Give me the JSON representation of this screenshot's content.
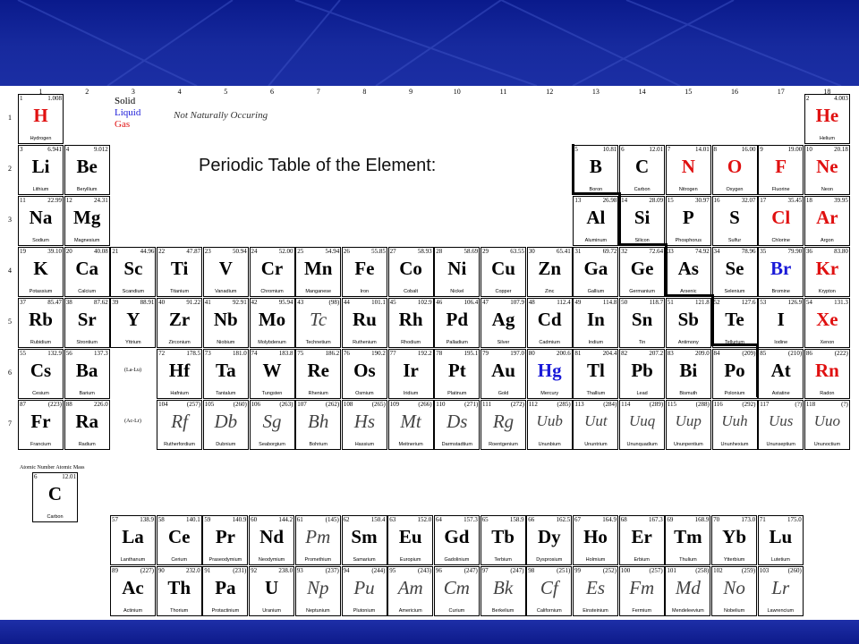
{
  "title": "Periodic Table of the Element:",
  "legend": {
    "solid": "Solid",
    "liquid": "Liquid",
    "gas": "Gas",
    "not_natural": "Not Naturally Occuring"
  },
  "group_numbers": [
    "1",
    "2",
    "3",
    "4",
    "5",
    "6",
    "7",
    "8",
    "9",
    "10",
    "11",
    "12",
    "13",
    "14",
    "15",
    "16",
    "17",
    "18"
  ],
  "period_numbers": [
    "1",
    "2",
    "3",
    "4",
    "5",
    "6",
    "7"
  ],
  "series_refs": {
    "lanthanide": "(La-Lu)",
    "actinide": "(Ac-Lr)"
  },
  "key": {
    "label": "Atomic Number  Atomic Mass",
    "element": {
      "num": "6",
      "mass": "12.01",
      "sym": "C",
      "name": "Carbon"
    }
  },
  "colors": {
    "gas": "#e01010",
    "liquid": "#1a1ad8",
    "banner": "#172a9e"
  },
  "elements": [
    {
      "n": "1",
      "m": "1.008",
      "s": "H",
      "name": "Hydrogen",
      "st": "gas",
      "g": 1,
      "p": 1
    },
    {
      "n": "2",
      "m": "4.003",
      "s": "He",
      "name": "Helium",
      "st": "gas",
      "g": 18,
      "p": 1
    },
    {
      "n": "3",
      "m": "6.941",
      "s": "Li",
      "name": "Lithium",
      "st": "solid",
      "g": 1,
      "p": 2
    },
    {
      "n": "4",
      "m": "9.012",
      "s": "Be",
      "name": "Beryllium",
      "st": "solid",
      "g": 2,
      "p": 2
    },
    {
      "n": "5",
      "m": "10.81",
      "s": "B",
      "name": "Boron",
      "st": "solid",
      "g": 13,
      "p": 2
    },
    {
      "n": "6",
      "m": "12.01",
      "s": "C",
      "name": "Carbon",
      "st": "solid",
      "g": 14,
      "p": 2
    },
    {
      "n": "7",
      "m": "14.01",
      "s": "N",
      "name": "Nitrogen",
      "st": "gas",
      "g": 15,
      "p": 2
    },
    {
      "n": "8",
      "m": "16.00",
      "s": "O",
      "name": "Oxygen",
      "st": "gas",
      "g": 16,
      "p": 2
    },
    {
      "n": "9",
      "m": "19.00",
      "s": "F",
      "name": "Fluorine",
      "st": "gas",
      "g": 17,
      "p": 2
    },
    {
      "n": "10",
      "m": "20.18",
      "s": "Ne",
      "name": "Neon",
      "st": "gas",
      "g": 18,
      "p": 2
    },
    {
      "n": "11",
      "m": "22.99",
      "s": "Na",
      "name": "Sodium",
      "st": "solid",
      "g": 1,
      "p": 3
    },
    {
      "n": "12",
      "m": "24.31",
      "s": "Mg",
      "name": "Magnesium",
      "st": "solid",
      "g": 2,
      "p": 3
    },
    {
      "n": "13",
      "m": "26.98",
      "s": "Al",
      "name": "Aluminum",
      "st": "solid",
      "g": 13,
      "p": 3
    },
    {
      "n": "14",
      "m": "28.09",
      "s": "Si",
      "name": "Silicon",
      "st": "solid",
      "g": 14,
      "p": 3
    },
    {
      "n": "15",
      "m": "30.97",
      "s": "P",
      "name": "Phosphorus",
      "st": "solid",
      "g": 15,
      "p": 3
    },
    {
      "n": "16",
      "m": "32.07",
      "s": "S",
      "name": "Sulfur",
      "st": "solid",
      "g": 16,
      "p": 3
    },
    {
      "n": "17",
      "m": "35.45",
      "s": "Cl",
      "name": "Chlorine",
      "st": "gas",
      "g": 17,
      "p": 3
    },
    {
      "n": "18",
      "m": "39.95",
      "s": "Ar",
      "name": "Argon",
      "st": "gas",
      "g": 18,
      "p": 3
    },
    {
      "n": "19",
      "m": "39.10",
      "s": "K",
      "name": "Potassium",
      "st": "solid",
      "g": 1,
      "p": 4
    },
    {
      "n": "20",
      "m": "40.08",
      "s": "Ca",
      "name": "Calcium",
      "st": "solid",
      "g": 2,
      "p": 4
    },
    {
      "n": "21",
      "m": "44.96",
      "s": "Sc",
      "name": "Scandium",
      "st": "solid",
      "g": 3,
      "p": 4
    },
    {
      "n": "22",
      "m": "47.87",
      "s": "Ti",
      "name": "Titanium",
      "st": "solid",
      "g": 4,
      "p": 4
    },
    {
      "n": "23",
      "m": "50.94",
      "s": "V",
      "name": "Vanadium",
      "st": "solid",
      "g": 5,
      "p": 4
    },
    {
      "n": "24",
      "m": "52.00",
      "s": "Cr",
      "name": "Chromium",
      "st": "solid",
      "g": 6,
      "p": 4
    },
    {
      "n": "25",
      "m": "54.94",
      "s": "Mn",
      "name": "Manganese",
      "st": "solid",
      "g": 7,
      "p": 4
    },
    {
      "n": "26",
      "m": "55.85",
      "s": "Fe",
      "name": "Iron",
      "st": "solid",
      "g": 8,
      "p": 4
    },
    {
      "n": "27",
      "m": "58.93",
      "s": "Co",
      "name": "Cobalt",
      "st": "solid",
      "g": 9,
      "p": 4
    },
    {
      "n": "28",
      "m": "58.69",
      "s": "Ni",
      "name": "Nickel",
      "st": "solid",
      "g": 10,
      "p": 4
    },
    {
      "n": "29",
      "m": "63.55",
      "s": "Cu",
      "name": "Copper",
      "st": "solid",
      "g": 11,
      "p": 4
    },
    {
      "n": "30",
      "m": "65.41",
      "s": "Zn",
      "name": "Zinc",
      "st": "solid",
      "g": 12,
      "p": 4
    },
    {
      "n": "31",
      "m": "69.72",
      "s": "Ga",
      "name": "Gallium",
      "st": "solid",
      "g": 13,
      "p": 4
    },
    {
      "n": "32",
      "m": "72.64",
      "s": "Ge",
      "name": "Germanium",
      "st": "solid",
      "g": 14,
      "p": 4
    },
    {
      "n": "33",
      "m": "74.92",
      "s": "As",
      "name": "Arsenic",
      "st": "solid",
      "g": 15,
      "p": 4
    },
    {
      "n": "34",
      "m": "78.96",
      "s": "Se",
      "name": "Selenium",
      "st": "solid",
      "g": 16,
      "p": 4
    },
    {
      "n": "35",
      "m": "79.90",
      "s": "Br",
      "name": "Bromine",
      "st": "liquid",
      "g": 17,
      "p": 4
    },
    {
      "n": "36",
      "m": "83.80",
      "s": "Kr",
      "name": "Krypton",
      "st": "gas",
      "g": 18,
      "p": 4
    },
    {
      "n": "37",
      "m": "85.47",
      "s": "Rb",
      "name": "Rubidium",
      "st": "solid",
      "g": 1,
      "p": 5
    },
    {
      "n": "38",
      "m": "87.62",
      "s": "Sr",
      "name": "Strontium",
      "st": "solid",
      "g": 2,
      "p": 5
    },
    {
      "n": "39",
      "m": "88.91",
      "s": "Y",
      "name": "Yttrium",
      "st": "solid",
      "g": 3,
      "p": 5
    },
    {
      "n": "40",
      "m": "91.22",
      "s": "Zr",
      "name": "Zirconium",
      "st": "solid",
      "g": 4,
      "p": 5
    },
    {
      "n": "41",
      "m": "92.91",
      "s": "Nb",
      "name": "Niobium",
      "st": "solid",
      "g": 5,
      "p": 5
    },
    {
      "n": "42",
      "m": "95.94",
      "s": "Mo",
      "name": "Molybdenum",
      "st": "solid",
      "g": 6,
      "p": 5
    },
    {
      "n": "43",
      "m": "(98)",
      "s": "Tc",
      "name": "Technetium",
      "st": "synthetic",
      "g": 7,
      "p": 5
    },
    {
      "n": "44",
      "m": "101.1",
      "s": "Ru",
      "name": "Ruthenium",
      "st": "solid",
      "g": 8,
      "p": 5
    },
    {
      "n": "45",
      "m": "102.9",
      "s": "Rh",
      "name": "Rhodium",
      "st": "solid",
      "g": 9,
      "p": 5
    },
    {
      "n": "46",
      "m": "106.4",
      "s": "Pd",
      "name": "Palladium",
      "st": "solid",
      "g": 10,
      "p": 5
    },
    {
      "n": "47",
      "m": "107.9",
      "s": "Ag",
      "name": "Silver",
      "st": "solid",
      "g": 11,
      "p": 5
    },
    {
      "n": "48",
      "m": "112.4",
      "s": "Cd",
      "name": "Cadmium",
      "st": "solid",
      "g": 12,
      "p": 5
    },
    {
      "n": "49",
      "m": "114.8",
      "s": "In",
      "name": "Indium",
      "st": "solid",
      "g": 13,
      "p": 5
    },
    {
      "n": "50",
      "m": "118.7",
      "s": "Sn",
      "name": "Tin",
      "st": "solid",
      "g": 14,
      "p": 5
    },
    {
      "n": "51",
      "m": "121.8",
      "s": "Sb",
      "name": "Antimony",
      "st": "solid",
      "g": 15,
      "p": 5
    },
    {
      "n": "52",
      "m": "127.6",
      "s": "Te",
      "name": "Tellurium",
      "st": "solid",
      "g": 16,
      "p": 5
    },
    {
      "n": "53",
      "m": "126.9",
      "s": "I",
      "name": "Iodine",
      "st": "solid",
      "g": 17,
      "p": 5
    },
    {
      "n": "54",
      "m": "131.3",
      "s": "Xe",
      "name": "Xenon",
      "st": "gas",
      "g": 18,
      "p": 5
    },
    {
      "n": "55",
      "m": "132.9",
      "s": "Cs",
      "name": "Cesium",
      "st": "solid",
      "g": 1,
      "p": 6
    },
    {
      "n": "56",
      "m": "137.3",
      "s": "Ba",
      "name": "Barium",
      "st": "solid",
      "g": 2,
      "p": 6
    },
    {
      "n": "72",
      "m": "178.5",
      "s": "Hf",
      "name": "Hafnium",
      "st": "solid",
      "g": 4,
      "p": 6
    },
    {
      "n": "73",
      "m": "181.0",
      "s": "Ta",
      "name": "Tantalum",
      "st": "solid",
      "g": 5,
      "p": 6
    },
    {
      "n": "74",
      "m": "183.8",
      "s": "W",
      "name": "Tungsten",
      "st": "solid",
      "g": 6,
      "p": 6
    },
    {
      "n": "75",
      "m": "186.2",
      "s": "Re",
      "name": "Rhenium",
      "st": "solid",
      "g": 7,
      "p": 6
    },
    {
      "n": "76",
      "m": "190.2",
      "s": "Os",
      "name": "Osmium",
      "st": "solid",
      "g": 8,
      "p": 6
    },
    {
      "n": "77",
      "m": "192.2",
      "s": "Ir",
      "name": "Iridium",
      "st": "solid",
      "g": 9,
      "p": 6
    },
    {
      "n": "78",
      "m": "195.1",
      "s": "Pt",
      "name": "Platinum",
      "st": "solid",
      "g": 10,
      "p": 6
    },
    {
      "n": "79",
      "m": "197.0",
      "s": "Au",
      "name": "Gold",
      "st": "solid",
      "g": 11,
      "p": 6
    },
    {
      "n": "80",
      "m": "200.6",
      "s": "Hg",
      "name": "Mercury",
      "st": "liquid",
      "g": 12,
      "p": 6
    },
    {
      "n": "81",
      "m": "204.4",
      "s": "Tl",
      "name": "Thallium",
      "st": "solid",
      "g": 13,
      "p": 6
    },
    {
      "n": "82",
      "m": "207.2",
      "s": "Pb",
      "name": "Lead",
      "st": "solid",
      "g": 14,
      "p": 6
    },
    {
      "n": "83",
      "m": "209.0",
      "s": "Bi",
      "name": "Bismuth",
      "st": "solid",
      "g": 15,
      "p": 6
    },
    {
      "n": "84",
      "m": "(209)",
      "s": "Po",
      "name": "Polonium",
      "st": "solid",
      "g": 16,
      "p": 6
    },
    {
      "n": "85",
      "m": "(210)",
      "s": "At",
      "name": "Astatine",
      "st": "solid",
      "g": 17,
      "p": 6
    },
    {
      "n": "86",
      "m": "(222)",
      "s": "Rn",
      "name": "Radon",
      "st": "gas",
      "g": 18,
      "p": 6
    },
    {
      "n": "87",
      "m": "(223)",
      "s": "Fr",
      "name": "Francium",
      "st": "solid",
      "g": 1,
      "p": 7
    },
    {
      "n": "88",
      "m": "226.0",
      "s": "Ra",
      "name": "Radium",
      "st": "solid",
      "g": 2,
      "p": 7
    },
    {
      "n": "104",
      "m": "(257)",
      "s": "Rf",
      "name": "Rutherfordium",
      "st": "synthetic",
      "g": 4,
      "p": 7
    },
    {
      "n": "105",
      "m": "(260)",
      "s": "Db",
      "name": "Dubnium",
      "st": "synthetic",
      "g": 5,
      "p": 7
    },
    {
      "n": "106",
      "m": "(263)",
      "s": "Sg",
      "name": "Seaborgium",
      "st": "synthetic",
      "g": 6,
      "p": 7
    },
    {
      "n": "107",
      "m": "(262)",
      "s": "Bh",
      "name": "Bohrium",
      "st": "synthetic",
      "g": 7,
      "p": 7
    },
    {
      "n": "108",
      "m": "(265)",
      "s": "Hs",
      "name": "Hassium",
      "st": "synthetic",
      "g": 8,
      "p": 7
    },
    {
      "n": "109",
      "m": "(266)",
      "s": "Mt",
      "name": "Meitnerium",
      "st": "synthetic",
      "g": 9,
      "p": 7
    },
    {
      "n": "110",
      "m": "(271)",
      "s": "Ds",
      "name": "Darmstadtium",
      "st": "synthetic",
      "g": 10,
      "p": 7
    },
    {
      "n": "111",
      "m": "(272)",
      "s": "Rg",
      "name": "Roentgenium",
      "st": "synthetic",
      "g": 11,
      "p": 7
    },
    {
      "n": "112",
      "m": "(285)",
      "s": "Uub",
      "name": "Ununbium",
      "st": "unk",
      "g": 12,
      "p": 7
    },
    {
      "n": "113",
      "m": "(284)",
      "s": "Uut",
      "name": "Ununtrium",
      "st": "unk",
      "g": 13,
      "p": 7
    },
    {
      "n": "114",
      "m": "(289)",
      "s": "Uuq",
      "name": "Ununquadium",
      "st": "unk",
      "g": 14,
      "p": 7
    },
    {
      "n": "115",
      "m": "(288)",
      "s": "Uup",
      "name": "Ununpentium",
      "st": "unk",
      "g": 15,
      "p": 7
    },
    {
      "n": "116",
      "m": "(292)",
      "s": "Uuh",
      "name": "Ununhexium",
      "st": "unk",
      "g": 16,
      "p": 7
    },
    {
      "n": "117",
      "m": "(?)",
      "s": "Uus",
      "name": "Ununseptium",
      "st": "unk",
      "g": 17,
      "p": 7
    },
    {
      "n": "118",
      "m": "(?)",
      "s": "Uuo",
      "name": "Ununoctium",
      "st": "unk",
      "g": 18,
      "p": 7
    }
  ],
  "lanthanides": [
    {
      "n": "57",
      "m": "138.9",
      "s": "La",
      "name": "Lanthanum",
      "st": "solid"
    },
    {
      "n": "58",
      "m": "140.1",
      "s": "Ce",
      "name": "Cerium",
      "st": "solid"
    },
    {
      "n": "59",
      "m": "140.9",
      "s": "Pr",
      "name": "Praseodymium",
      "st": "solid"
    },
    {
      "n": "60",
      "m": "144.2",
      "s": "Nd",
      "name": "Neodymium",
      "st": "solid"
    },
    {
      "n": "61",
      "m": "(145)",
      "s": "Pm",
      "name": "Promethium",
      "st": "synthetic"
    },
    {
      "n": "62",
      "m": "150.4",
      "s": "Sm",
      "name": "Samarium",
      "st": "solid"
    },
    {
      "n": "63",
      "m": "152.0",
      "s": "Eu",
      "name": "Europium",
      "st": "solid"
    },
    {
      "n": "64",
      "m": "157.3",
      "s": "Gd",
      "name": "Gadolinium",
      "st": "solid"
    },
    {
      "n": "65",
      "m": "158.9",
      "s": "Tb",
      "name": "Terbium",
      "st": "solid"
    },
    {
      "n": "66",
      "m": "162.5",
      "s": "Dy",
      "name": "Dysprosium",
      "st": "solid"
    },
    {
      "n": "67",
      "m": "164.9",
      "s": "Ho",
      "name": "Holmium",
      "st": "solid"
    },
    {
      "n": "68",
      "m": "167.3",
      "s": "Er",
      "name": "Erbium",
      "st": "solid"
    },
    {
      "n": "69",
      "m": "168.9",
      "s": "Tm",
      "name": "Thulium",
      "st": "solid"
    },
    {
      "n": "70",
      "m": "173.0",
      "s": "Yb",
      "name": "Ytterbium",
      "st": "solid"
    },
    {
      "n": "71",
      "m": "175.0",
      "s": "Lu",
      "name": "Lutetium",
      "st": "solid"
    }
  ],
  "actinides": [
    {
      "n": "89",
      "m": "(227)",
      "s": "Ac",
      "name": "Actinium",
      "st": "solid"
    },
    {
      "n": "90",
      "m": "232.0",
      "s": "Th",
      "name": "Thorium",
      "st": "solid"
    },
    {
      "n": "91",
      "m": "(231)",
      "s": "Pa",
      "name": "Protactinium",
      "st": "solid"
    },
    {
      "n": "92",
      "m": "238.0",
      "s": "U",
      "name": "Uranium",
      "st": "solid"
    },
    {
      "n": "93",
      "m": "(237)",
      "s": "Np",
      "name": "Neptunium",
      "st": "synthetic"
    },
    {
      "n": "94",
      "m": "(244)",
      "s": "Pu",
      "name": "Plutonium",
      "st": "synthetic"
    },
    {
      "n": "95",
      "m": "(243)",
      "s": "Am",
      "name": "Americium",
      "st": "synthetic"
    },
    {
      "n": "96",
      "m": "(247)",
      "s": "Cm",
      "name": "Curium",
      "st": "synthetic"
    },
    {
      "n": "97",
      "m": "(247)",
      "s": "Bk",
      "name": "Berkelium",
      "st": "synthetic"
    },
    {
      "n": "98",
      "m": "(251)",
      "s": "Cf",
      "name": "Californium",
      "st": "synthetic"
    },
    {
      "n": "99",
      "m": "(252)",
      "s": "Es",
      "name": "Einsteinium",
      "st": "synthetic"
    },
    {
      "n": "100",
      "m": "(257)",
      "s": "Fm",
      "name": "Fermium",
      "st": "synthetic"
    },
    {
      "n": "101",
      "m": "(258)",
      "s": "Md",
      "name": "Mendeleevium",
      "st": "synthetic"
    },
    {
      "n": "102",
      "m": "(259)",
      "s": "No",
      "name": "Nobelium",
      "st": "synthetic"
    },
    {
      "n": "103",
      "m": "(260)",
      "s": "Lr",
      "name": "Lawrencium",
      "st": "synthetic"
    }
  ]
}
